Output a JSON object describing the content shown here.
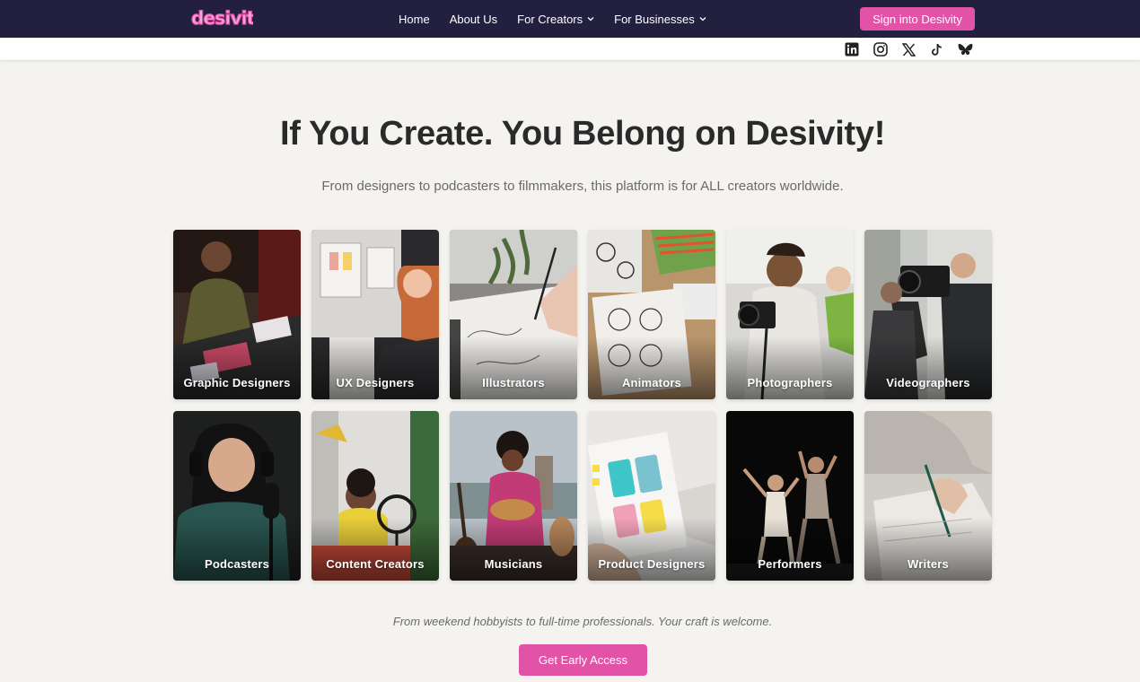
{
  "brand": {
    "logo_text": "desivity",
    "accent_color": "#e253a8",
    "nav_bg": "#221f3f"
  },
  "nav": {
    "links": [
      {
        "label": "Home"
      },
      {
        "label": "About Us"
      },
      {
        "label": "For Creators",
        "dropdown": true
      },
      {
        "label": "For Businesses",
        "dropdown": true
      }
    ],
    "signin_label": "Sign into Desivity"
  },
  "socials": [
    "linkedin-icon",
    "instagram-icon",
    "x-icon",
    "tiktok-icon",
    "bluesky-icon"
  ],
  "hero": {
    "title": "If You Create. You Belong on Desivity!",
    "subtitle": "From designers to podcasters to filmmakers, this platform is for ALL creators worldwide."
  },
  "creators": [
    {
      "label": "Graphic Designers"
    },
    {
      "label": "UX Designers"
    },
    {
      "label": "Illustrators"
    },
    {
      "label": "Animators"
    },
    {
      "label": "Photographers"
    },
    {
      "label": "Videographers"
    },
    {
      "label": "Podcasters"
    },
    {
      "label": "Content Creators"
    },
    {
      "label": "Musicians"
    },
    {
      "label": "Product Designers"
    },
    {
      "label": "Performers"
    },
    {
      "label": "Writers"
    }
  ],
  "footer": {
    "note": "From weekend hobbyists to full-time professionals. Your craft is welcome.",
    "cta_label": "Get Early Access"
  }
}
